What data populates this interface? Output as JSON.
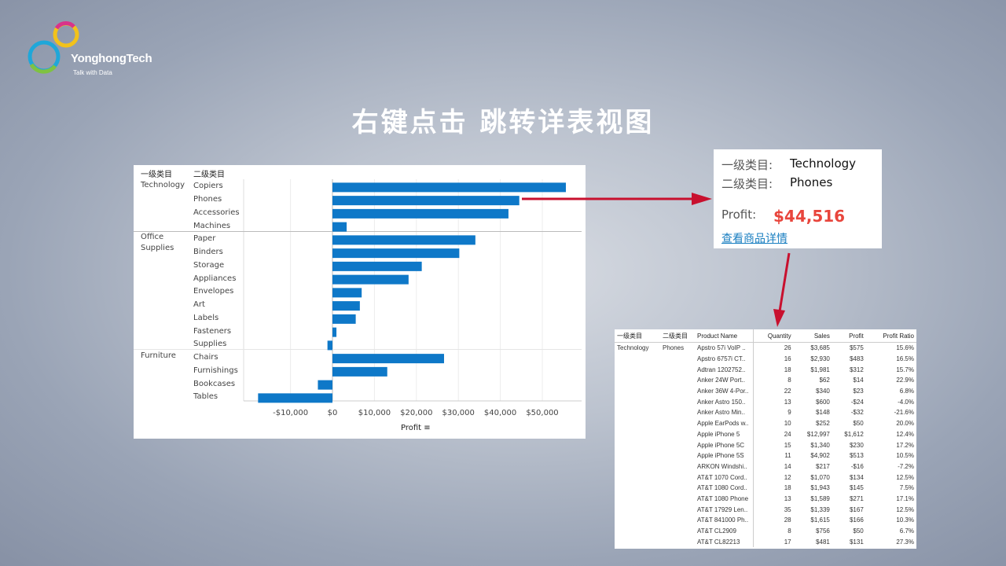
{
  "logo": {
    "name": "YonghongTech",
    "tagline": "Talk with Data"
  },
  "slide_title": "右键点击  跳转详表视图",
  "chart": {
    "header_cat1": "一级类目",
    "header_cat2": "二级类目",
    "groups": [
      {
        "name": "Technology",
        "items": [
          "Copiers",
          "Phones",
          "Accessories",
          "Machines"
        ]
      },
      {
        "name": "Office\nSupplies",
        "items": [
          "Paper",
          "Binders",
          "Storage",
          "Appliances",
          "Envelopes",
          "Art",
          "Labels",
          "Fasteners",
          "Supplies"
        ]
      },
      {
        "name": "Furniture",
        "items": [
          "Chairs",
          "Furnishings",
          "Bookcases",
          "Tables"
        ]
      }
    ],
    "x_title": "Profit"
  },
  "chart_data": {
    "type": "bar",
    "orientation": "horizontal",
    "categories": [
      "Copiers",
      "Phones",
      "Accessories",
      "Machines",
      "Paper",
      "Binders",
      "Storage",
      "Appliances",
      "Envelopes",
      "Art",
      "Labels",
      "Fasteners",
      "Supplies",
      "Chairs",
      "Furnishings",
      "Bookcases",
      "Tables"
    ],
    "values": [
      55618,
      44516,
      41937,
      3385,
      34054,
      30222,
      21279,
      18138,
      6964,
      6528,
      5546,
      950,
      -1189,
      26590,
      13059,
      -3473,
      -17725
    ],
    "xlabel": "Profit",
    "xlim": [
      -18000,
      60000
    ],
    "xticks": [
      -10000,
      0,
      10000,
      20000,
      30000,
      40000,
      50000
    ],
    "xtick_labels": [
      "-$10,000",
      "$0",
      "$10,000",
      "$20,000",
      "$30,000",
      "$40,000",
      "$50,000"
    ],
    "bar_color": "#0e78c8",
    "grid": true
  },
  "tooltip": {
    "cat1_label": "一级类目:",
    "cat1_value": "Technology",
    "cat2_label": "二级类目:",
    "cat2_value": "Phones",
    "profit_label": "Profit:",
    "profit_value": "$44,516",
    "link_text": "查看商品详情"
  },
  "detail_table": {
    "columns": [
      "一级类目",
      "二级类目",
      "Product Name",
      "Quantity",
      "Sales",
      "Profit",
      "Profit Ratio"
    ],
    "cat1": "Technology",
    "cat2": "Phones",
    "rows": [
      [
        "Apstro 57i VoIP ..",
        "26",
        "$3,685",
        "$575",
        "15.6%"
      ],
      [
        "Apstro 6757i CT..",
        "16",
        "$2,930",
        "$483",
        "16.5%"
      ],
      [
        "Adtran 1202752..",
        "18",
        "$1,981",
        "$312",
        "15.7%"
      ],
      [
        "Anker 24W Port..",
        "8",
        "$62",
        "$14",
        "22.9%"
      ],
      [
        "Anker 36W 4-Por..",
        "22",
        "$340",
        "$23",
        "6.8%"
      ],
      [
        "Anker Astro 150..",
        "13",
        "$600",
        "-$24",
        "-4.0%"
      ],
      [
        "Anker Astro Min..",
        "9",
        "$148",
        "-$32",
        "-21.6%"
      ],
      [
        "Apple EarPods w..",
        "10",
        "$252",
        "$50",
        "20.0%"
      ],
      [
        "Apple iPhone 5",
        "24",
        "$12,997",
        "$1,612",
        "12.4%"
      ],
      [
        "Apple iPhone 5C",
        "15",
        "$1,340",
        "$230",
        "17.2%"
      ],
      [
        "Apple iPhone 5S",
        "11",
        "$4,902",
        "$513",
        "10.5%"
      ],
      [
        "ARKON Windshi..",
        "14",
        "$217",
        "-$16",
        "-7.2%"
      ],
      [
        "AT&T 1070 Cord..",
        "12",
        "$1,070",
        "$134",
        "12.5%"
      ],
      [
        "AT&T 1080 Cord..",
        "18",
        "$1,943",
        "$145",
        "7.5%"
      ],
      [
        "AT&T 1080 Phone",
        "13",
        "$1,589",
        "$271",
        "17.1%"
      ],
      [
        "AT&T 17929 Len..",
        "35",
        "$1,339",
        "$167",
        "12.5%"
      ],
      [
        "AT&T 841000 Ph..",
        "28",
        "$1,615",
        "$166",
        "10.3%"
      ],
      [
        "AT&T CL2909",
        "8",
        "$756",
        "$50",
        "6.7%"
      ],
      [
        "AT&T CL82213",
        "17",
        "$481",
        "$131",
        "27.3%"
      ]
    ]
  },
  "colors": {
    "arrow": "#c8102e",
    "bar": "#0e78c8",
    "profit_value": "#e8453c",
    "link": "#1a7fc1"
  }
}
